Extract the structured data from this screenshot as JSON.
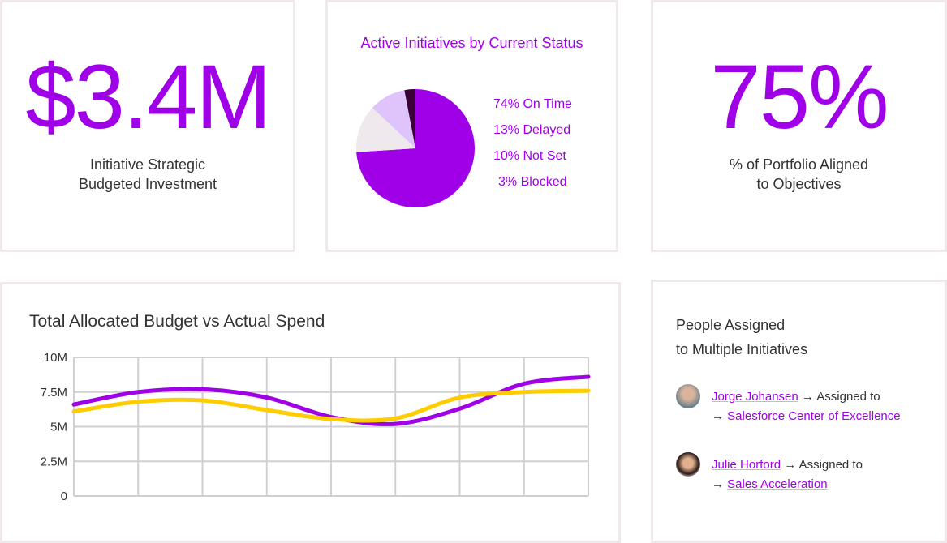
{
  "budget": {
    "value": "$3.4M",
    "caption_line1": "Initiative Strategic",
    "caption_line2": "Budgeted Investment"
  },
  "status": {
    "title": "Active Initiatives by Current Status",
    "chart_data": {
      "type": "pie",
      "title": "Active Initiatives by Current Status",
      "slices": [
        {
          "label": "74% On Time",
          "value": 74,
          "color": "#a000e8"
        },
        {
          "label": "13% Delayed",
          "value": 13,
          "color": "#efe8ec"
        },
        {
          "label": "10% Not Set",
          "value": 10,
          "color": "#dfc4fb"
        },
        {
          "label": "3% Blocked",
          "value": 3,
          "color": "#3a0038"
        }
      ]
    }
  },
  "aligned": {
    "value": "75%",
    "caption_line1": "% of Portfolio Aligned",
    "caption_line2": "to Objectives"
  },
  "chart_data": {
    "type": "line",
    "title": "Total Allocated Budget vs Actual Spend",
    "x": [
      0,
      1,
      2,
      3,
      4,
      5,
      6,
      7,
      8
    ],
    "ylim": [
      0,
      10
    ],
    "yticks": [
      "0",
      "2.5M",
      "5M",
      "7.5M",
      "10M"
    ],
    "ytick_values": [
      0,
      2.5,
      5,
      7.5,
      10
    ],
    "grid": true,
    "series": [
      {
        "color": "#a000e8",
        "values": [
          6.6,
          7.5,
          7.7,
          7.1,
          5.7,
          5.2,
          6.3,
          8.1,
          8.6
        ]
      },
      {
        "color": "#ffcc00",
        "values": [
          6.1,
          6.8,
          6.9,
          6.2,
          5.55,
          5.6,
          7.1,
          7.5,
          7.6
        ]
      }
    ]
  },
  "people": {
    "title_line1": "People Assigned",
    "title_line2": "to Multiple Initiatives",
    "assigned_text": "→ Assigned to",
    "arrow": "→",
    "items": [
      {
        "name": "Jorge Johansen",
        "initiative": "Salesforce Center of Excellence"
      },
      {
        "name": "Julie Horford",
        "initiative": "Sales Acceleration"
      }
    ]
  }
}
